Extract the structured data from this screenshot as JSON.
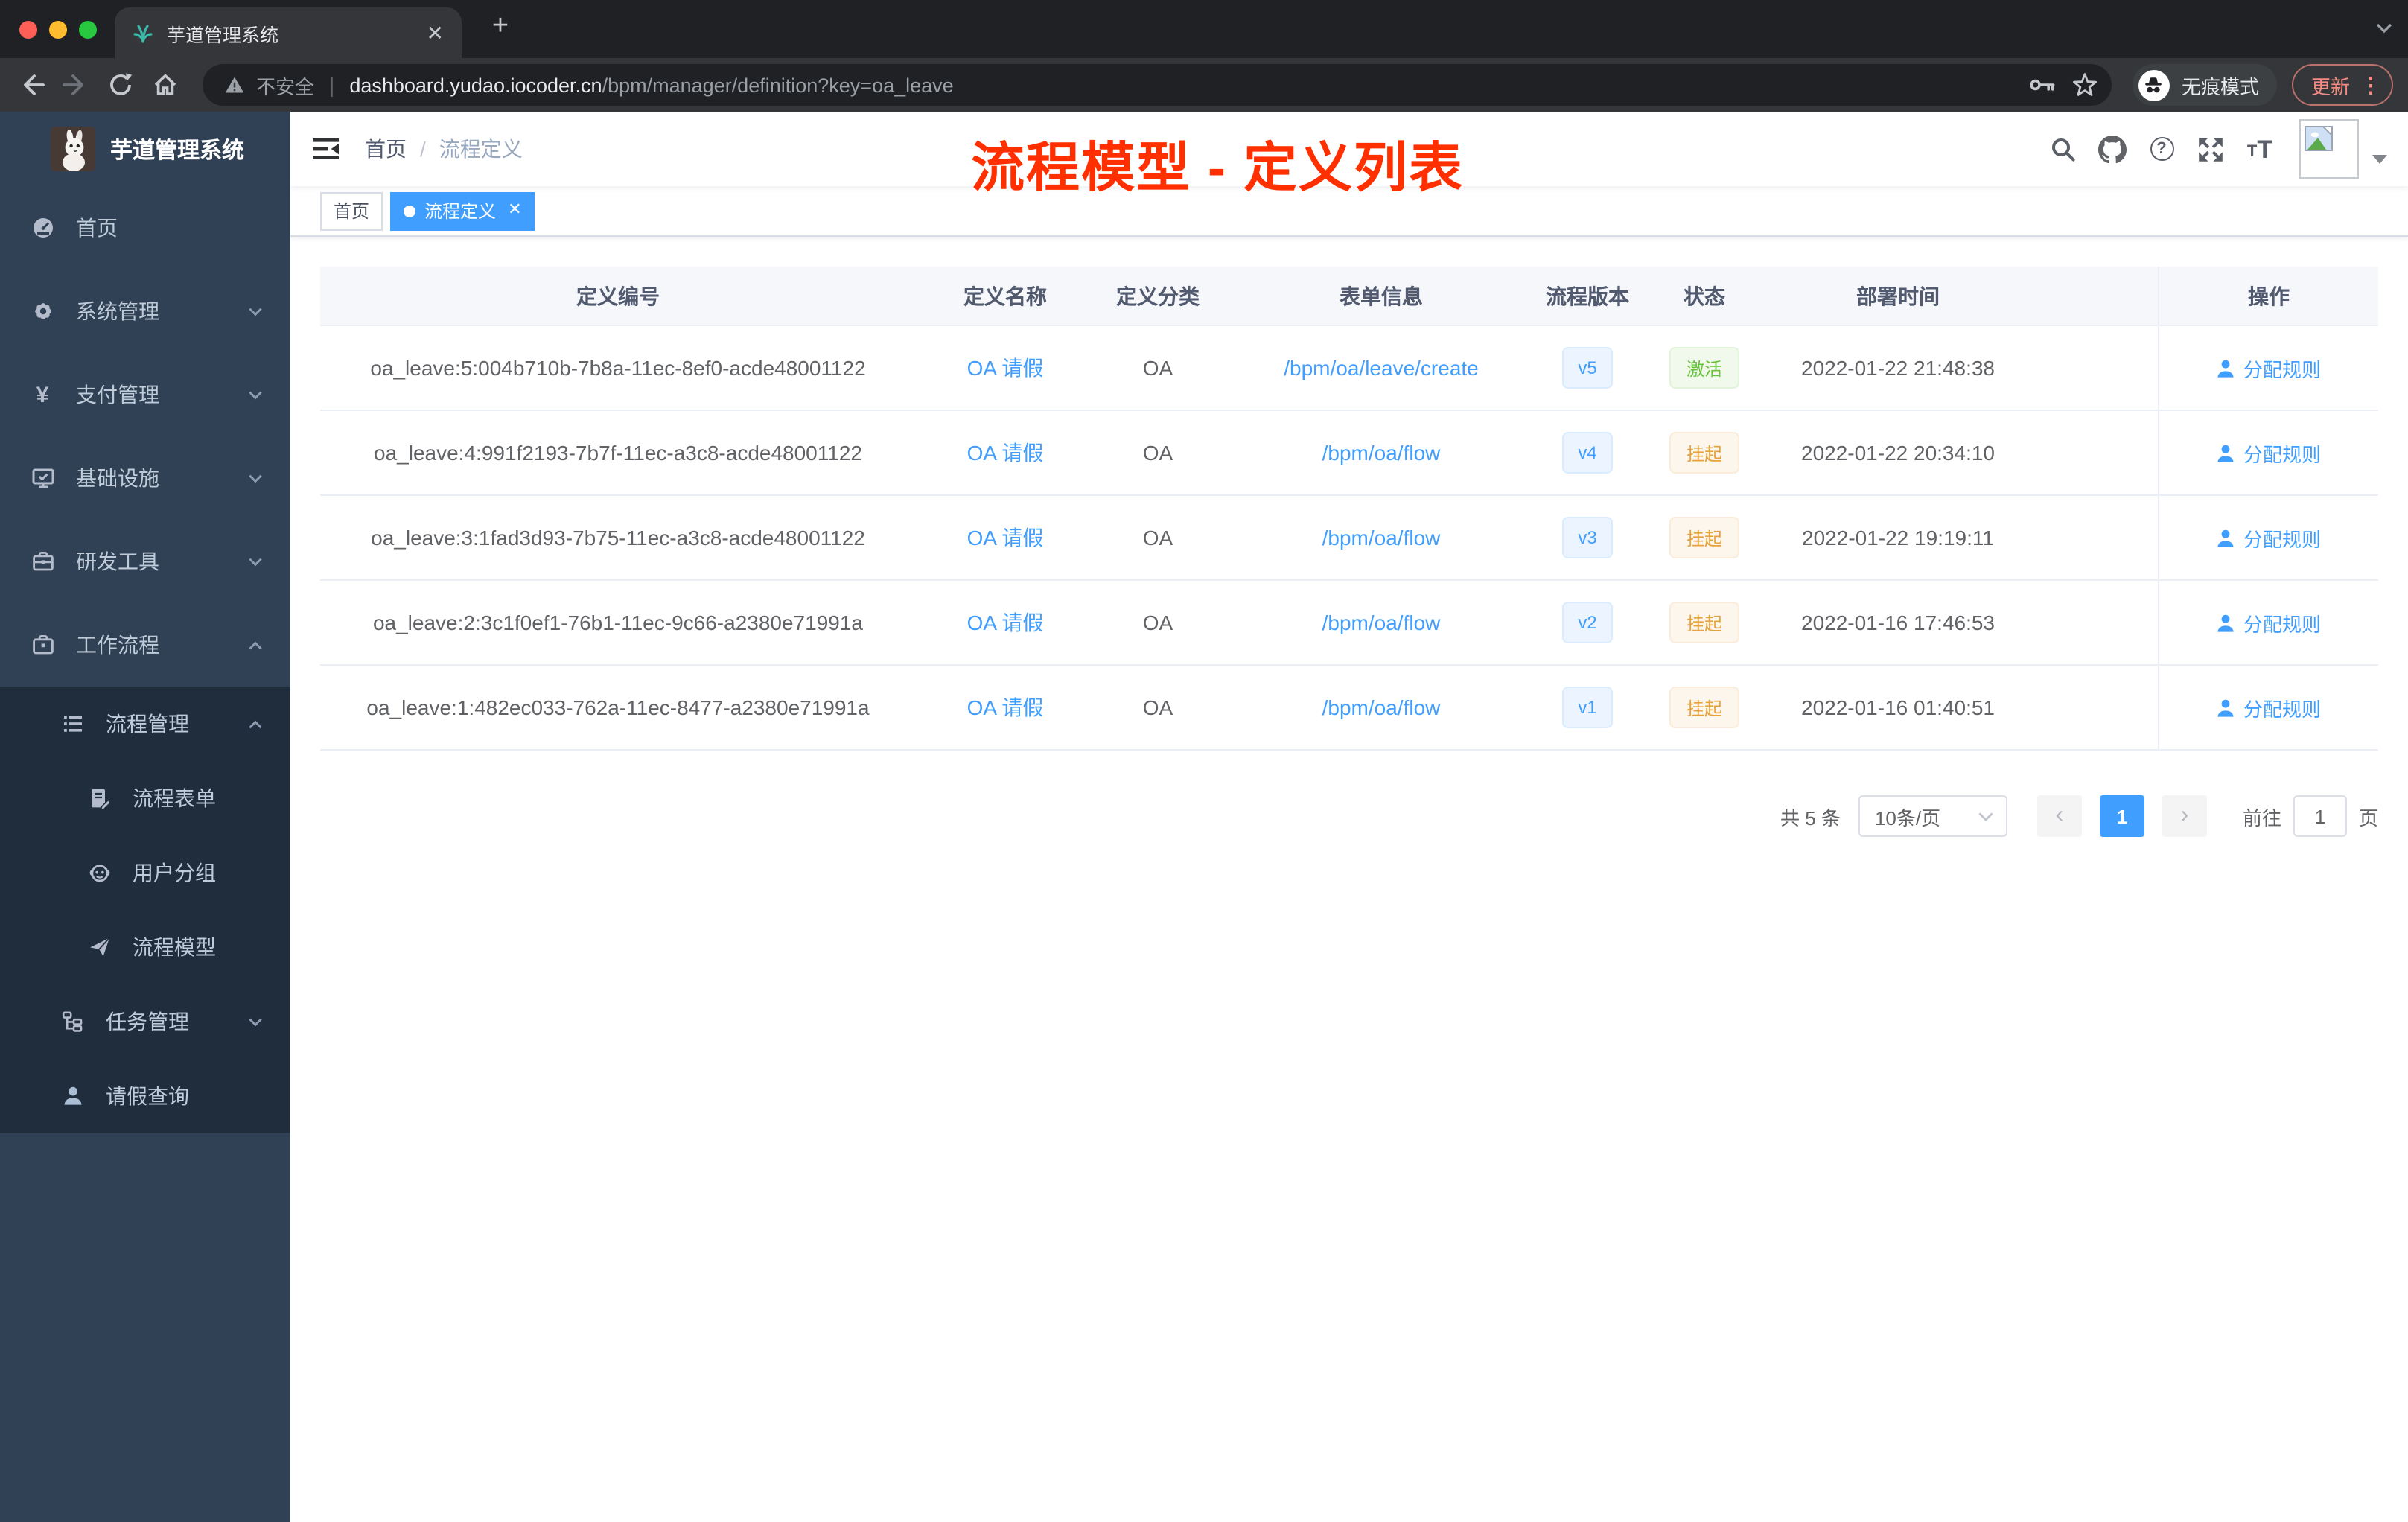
{
  "colors": {
    "accent": "#409eff",
    "success": "#67c23a",
    "warning": "#e6a23c",
    "sidebar_bg": "#304156",
    "submenu_bg": "#1f2d3d",
    "annotation": "#ff2f00"
  },
  "browser": {
    "tab": {
      "title": "芋道管理系统",
      "close_icon": "✕",
      "favicon": "grass-sprout-icon"
    },
    "new_tab_icon": "+",
    "security_chip": "不安全",
    "url_host": "dashboard.yudao.iocoder.cn",
    "url_path": "/bpm/manager/definition?key=oa_leave",
    "url_separator": "|",
    "incognito_label": "无痕模式",
    "update_button": "更新",
    "menu_dots_icon": "⋮",
    "toolbar_icons": [
      "back",
      "forward",
      "reload",
      "home",
      "key",
      "star"
    ]
  },
  "annotation": {
    "text": "流程模型 - 定义列表"
  },
  "sidebar": {
    "brand": "芋道管理系统",
    "items": [
      {
        "label": "首页",
        "icon": "dashboard"
      },
      {
        "label": "系统管理",
        "icon": "gear",
        "chevron": "down"
      },
      {
        "label": "支付管理",
        "icon": "yen",
        "chevron": "down"
      },
      {
        "label": "基础设施",
        "icon": "monitor-check",
        "chevron": "down"
      },
      {
        "label": "研发工具",
        "icon": "toolbox",
        "chevron": "down"
      },
      {
        "label": "工作流程",
        "icon": "briefcase",
        "chevron": "up"
      }
    ],
    "workflow_submenu": [
      {
        "label": "流程管理",
        "icon": "tree-list",
        "chevron": "up"
      },
      {
        "label": "流程表单",
        "icon": "form-edit"
      },
      {
        "label": "用户分组",
        "icon": "robot-face"
      },
      {
        "label": "流程模型",
        "icon": "paper-plane"
      },
      {
        "label": "任务管理",
        "icon": "org-tree",
        "chevron": "down"
      },
      {
        "label": "请假查询",
        "icon": "user"
      }
    ]
  },
  "navbar": {
    "breadcrumb": [
      "首页",
      "流程定义"
    ],
    "separator": "/",
    "right_icons": [
      "search",
      "github",
      "help",
      "fullscreen",
      "font-size"
    ]
  },
  "tags": [
    {
      "label": "首页",
      "active": false
    },
    {
      "label": "流程定义",
      "active": true,
      "close_icon": "✕"
    }
  ],
  "table": {
    "headers": [
      "定义编号",
      "定义名称",
      "定义分类",
      "表单信息",
      "流程版本",
      "状态",
      "部署时间",
      "操作"
    ],
    "rows": [
      {
        "id": "oa_leave:5:004b710b-7b8a-11ec-8ef0-acde48001122",
        "name": "OA 请假",
        "category": "OA",
        "form": "/bpm/oa/leave/create",
        "version": "v5",
        "status": {
          "label": "激活",
          "type": "success"
        },
        "deploy_time": "2022-01-22 21:48:38",
        "action": "分配规则"
      },
      {
        "id": "oa_leave:4:991f2193-7b7f-11ec-a3c8-acde48001122",
        "name": "OA 请假",
        "category": "OA",
        "form": "/bpm/oa/flow",
        "version": "v4",
        "status": {
          "label": "挂起",
          "type": "warning"
        },
        "deploy_time": "2022-01-22 20:34:10",
        "action": "分配规则"
      },
      {
        "id": "oa_leave:3:1fad3d93-7b75-11ec-a3c8-acde48001122",
        "name": "OA 请假",
        "category": "OA",
        "form": "/bpm/oa/flow",
        "version": "v3",
        "status": {
          "label": "挂起",
          "type": "warning"
        },
        "deploy_time": "2022-01-22 19:19:11",
        "action": "分配规则"
      },
      {
        "id": "oa_leave:2:3c1f0ef1-76b1-11ec-9c66-a2380e71991a",
        "name": "OA 请假",
        "category": "OA",
        "form": "/bpm/oa/flow",
        "version": "v2",
        "status": {
          "label": "挂起",
          "type": "warning"
        },
        "deploy_time": "2022-01-16 17:46:53",
        "action": "分配规则"
      },
      {
        "id": "oa_leave:1:482ec033-762a-11ec-8477-a2380e71991a",
        "name": "OA 请假",
        "category": "OA",
        "form": "/bpm/oa/flow",
        "version": "v1",
        "status": {
          "label": "挂起",
          "type": "warning"
        },
        "deploy_time": "2022-01-16 01:40:51",
        "action": "分配规则"
      }
    ]
  },
  "pagination": {
    "total": "共 5 条",
    "page_size": "10条/页",
    "prev_icon": "‹",
    "current": "1",
    "next_icon": "›",
    "goto_label": "前往",
    "goto_value": "1",
    "unit": "页"
  }
}
